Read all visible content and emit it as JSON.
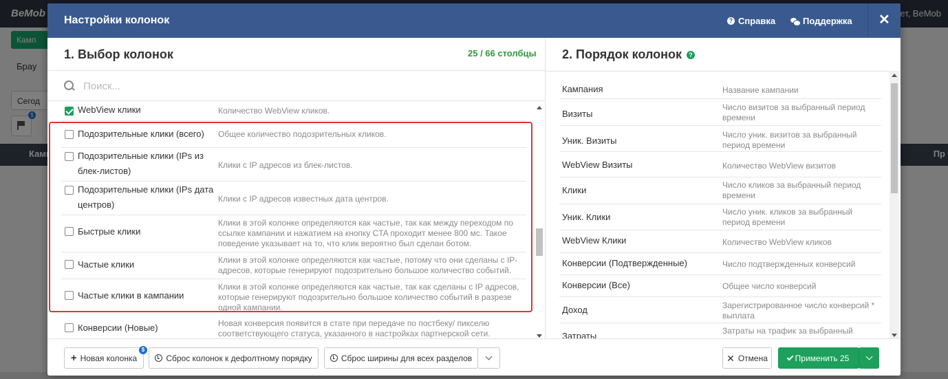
{
  "background": {
    "logo": "BeMob",
    "header_right": "ет, BeMob",
    "campaigns_button": "Камп",
    "browser_tab": "Брау",
    "date_button": "Сегод",
    "table_head_left": "Камп",
    "table_head_right": "Пр"
  },
  "modal": {
    "title": "Настройки колонок",
    "help_label": "Справка",
    "support_label": "Поддержка",
    "close_label": "✕"
  },
  "left": {
    "title": "1. Выбор колонок",
    "count": "25 / 66 столбцы",
    "search_placeholder": "Поиск...",
    "items": [
      {
        "name": "WebView клики",
        "desc": "Количество WebView кликов.",
        "checked": true
      },
      {
        "name": "Подозрительные клики (всего)",
        "desc": "Общее количество подозрительных кликов.",
        "checked": false
      },
      {
        "name": "Подозрительные клики (IPs из блек-листов)",
        "desc": "Клики с IP адресов из блек-листов.",
        "checked": false
      },
      {
        "name": "Подозрительные клики (IPs дата центров)",
        "desc": "Клики с IP адресов известных дата центров.",
        "checked": false
      },
      {
        "name": "Быстрые клики",
        "desc": "Клики в этой колонке определяются как частые, так как между переходом по ссылке кампании и нажатием на кнопку CTA проходит менее 800 мс. Такое поведение указывает на то, что клик вероятно был сделан ботом.",
        "checked": false
      },
      {
        "name": "Частые клики",
        "desc": "Клики в этой колонке определяются как частые, потому что они сделаны с IP-адресов, которые генерируют подозрительно большое количество событий.",
        "checked": false
      },
      {
        "name": "Частые клики в кампании",
        "desc": "Клики в этой колонке определяются как частые, так как сделаны с IP адресов, которые генерируют подозрительно большое количество событий в разрезе одной кампании.",
        "checked": false
      },
      {
        "name": "Конверсии (Новые)",
        "desc": "Новая конверсия появится в стате при передаче по постбеку/ пикселю соответствующего статуса, указанного в настройках партнерской сети.",
        "checked": false
      }
    ]
  },
  "right": {
    "title": "2. Порядок колонок",
    "help_icon": "?",
    "items": [
      {
        "name": "Кампания",
        "desc": "Название кампании"
      },
      {
        "name": "Визиты",
        "desc": "Число визитов за выбранный период времени"
      },
      {
        "name": "Уник. Визиты",
        "desc": "Число уник. визитов за выбранный период времени"
      },
      {
        "name": "WebView Визиты",
        "desc": "Количество WebView визитов"
      },
      {
        "name": "Клики",
        "desc": "Число кликов за выбранный период времени"
      },
      {
        "name": "Уник. Клики",
        "desc": "Число уник. кликов за выбранный период времени"
      },
      {
        "name": "WebView Клики",
        "desc": "Количество WebView кликов"
      },
      {
        "name": "Конверсии (Подтвержденные)",
        "desc": "Число подтвержденных конверсий"
      },
      {
        "name": "Конверсии (Все)",
        "desc": "Общее число конверсий"
      },
      {
        "name": "Доход",
        "desc": "Зарегистрированное число конверсий * выплата"
      },
      {
        "name": "Затраты",
        "desc": "Затраты на трафик за выбранный период времени"
      }
    ]
  },
  "footer": {
    "new_column": "Новая колонка",
    "new_badge": "$",
    "reset_order": "Сброс колонок к дефолтному порядку",
    "reset_width": "Сброс ширины для всех разделов",
    "cancel": "Отмена",
    "apply": "Применить 25"
  },
  "colors": {
    "header_bg": "#3a5a8f",
    "accent_green": "#1ca05c",
    "count_green": "#2d9a3a",
    "highlight_red": "#e03434"
  }
}
